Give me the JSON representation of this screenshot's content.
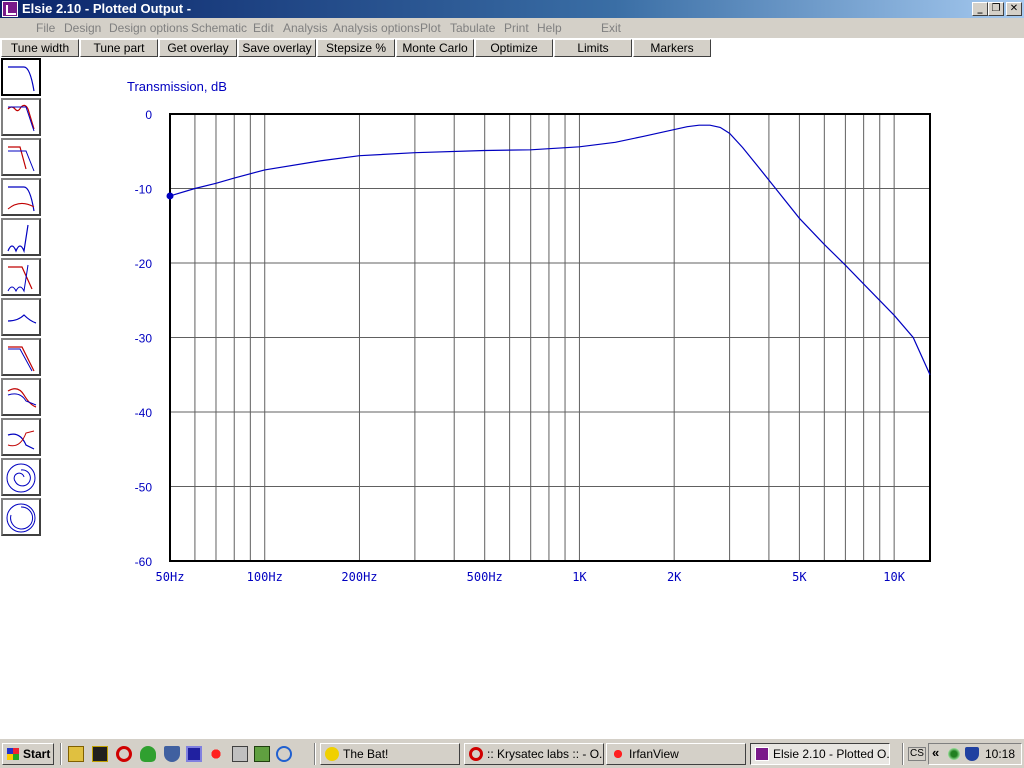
{
  "window": {
    "title": "Elsie 2.10 - Plotted Output -",
    "controls": {
      "minimize": "_",
      "restore": "❐",
      "close": "✕"
    }
  },
  "menu": [
    "File",
    "Design",
    "Design options",
    "Schematic",
    "Edit",
    "Analysis",
    "Analysis options",
    "Plot",
    "Tabulate",
    "Print",
    "Help",
    "Exit"
  ],
  "toolbar": [
    "Tune width",
    "Tune part",
    "Get overlay",
    "Save overlay",
    "Stepsize %",
    "Monte Carlo",
    "Optimize",
    "Limits",
    "Markers"
  ],
  "side_panel": {
    "buttons": [
      "lowpass-response-icon",
      "chebyshev-lowpass-icon",
      "elliptic-lowpass-icon",
      "lowpass-delay-icon",
      "stopband-notch-icon",
      "lowpass-notch-overlay-icon",
      "group-delay-icon",
      "lowpass-step-icon",
      "step-overlay-icon",
      "crossover-icon",
      "smith-chart-icon",
      "polar-chart-icon"
    ],
    "selected": 0
  },
  "chart_data": {
    "type": "line",
    "title": "Transmission, dB",
    "xscale": "log",
    "xlim": [
      50,
      13000
    ],
    "ylim": [
      -60,
      0
    ],
    "grid": true,
    "yticks": [
      0,
      -10,
      -20,
      -30,
      -40,
      -50,
      -60
    ],
    "xticks": [
      {
        "value": 50,
        "label": "50Hz"
      },
      {
        "value": 100,
        "label": "100Hz"
      },
      {
        "value": 200,
        "label": "200Hz"
      },
      {
        "value": 500,
        "label": "500Hz"
      },
      {
        "value": 1000,
        "label": "1K"
      },
      {
        "value": 2000,
        "label": "2K"
      },
      {
        "value": 5000,
        "label": "5K"
      },
      {
        "value": 10000,
        "label": "10K"
      }
    ],
    "minor_gridlines": [
      60,
      70,
      80,
      90,
      300,
      400,
      600,
      700,
      800,
      900,
      3000,
      4000,
      6000,
      7000,
      8000,
      9000
    ],
    "series": [
      {
        "color": "#0000c0",
        "x": [
          50,
          60,
          70,
          80,
          100,
          150,
          200,
          300,
          500,
          700,
          1000,
          1300,
          1600,
          2000,
          2200,
          2400,
          2600,
          2800,
          3000,
          3300,
          3700,
          4200,
          5000,
          6000,
          7000,
          8000,
          10000,
          11500,
          13000
        ],
        "y": [
          -11.0,
          -10.0,
          -9.3,
          -8.6,
          -7.5,
          -6.3,
          -5.6,
          -5.2,
          -4.9,
          -4.8,
          -4.4,
          -3.8,
          -3.0,
          -2.1,
          -1.7,
          -1.5,
          -1.5,
          -1.8,
          -2.6,
          -4.5,
          -7.1,
          -10.0,
          -14.0,
          -17.5,
          -20.3,
          -22.8,
          -27.0,
          -30.0,
          -35.0
        ]
      }
    ],
    "marker": {
      "x": 50,
      "y": -11.0,
      "color": "#0000c0"
    }
  },
  "taskbar": {
    "start_label": "Start",
    "quick_launch": [
      "desktop-icon",
      "winamp-icon",
      "opera-icon",
      "frog-icon",
      "shield-icon",
      "save-icon",
      "splat-icon",
      "info-icon",
      "calc-icon",
      "ie-icon"
    ],
    "tasks": [
      {
        "label": "The Bat!",
        "icon": "bat-icon",
        "active": false
      },
      {
        "label": ":: Krysatec labs :: - O...",
        "icon": "opera-icon",
        "active": false
      },
      {
        "label": "IrfanView",
        "icon": "irfanview-icon",
        "active": false
      },
      {
        "label": "Elsie 2.10 - Plotted O...",
        "icon": "elsie-icon",
        "active": true
      }
    ],
    "tray_lang": "CS",
    "tray_expand": "«",
    "clock": "10:18"
  }
}
